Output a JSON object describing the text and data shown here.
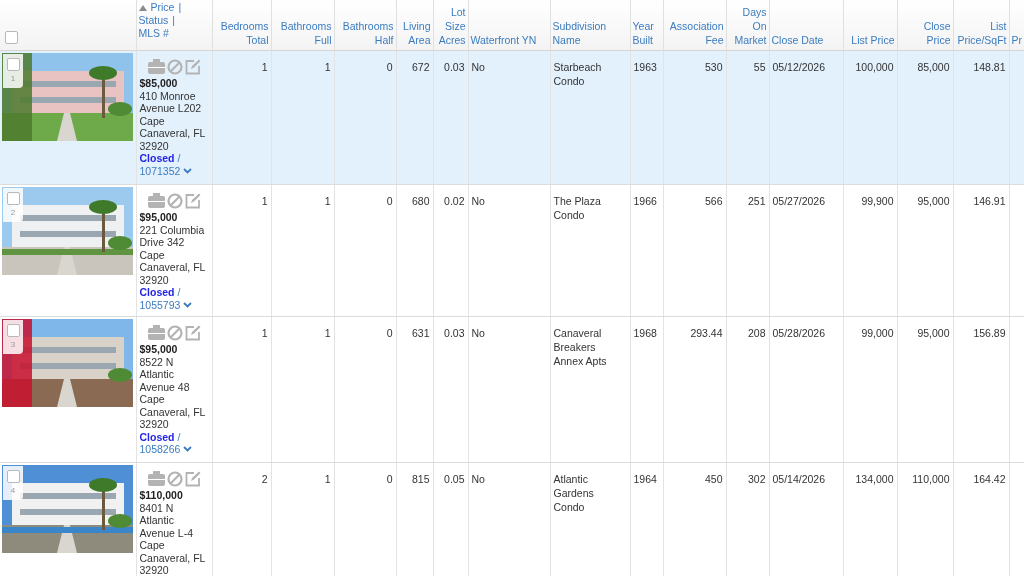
{
  "header": {
    "select_all_checked": false,
    "price_column": [
      {
        "text": "Price",
        "sep": "|"
      },
      {
        "text": "Status",
        "sep": "|"
      },
      {
        "text": "MLS #"
      }
    ],
    "columns": [
      {
        "label": "Bedrooms Total",
        "kind": "number"
      },
      {
        "label": "Bathrooms Full",
        "kind": "number"
      },
      {
        "label": "Bathrooms Half",
        "kind": "number"
      },
      {
        "label": "Living Area",
        "kind": "number"
      },
      {
        "label": "Lot Size Acres",
        "kind": "number"
      },
      {
        "label": "Waterfront YN",
        "kind": "text"
      },
      {
        "label": "Subdivision Name",
        "kind": "text"
      },
      {
        "label": "Year Built",
        "kind": "text"
      },
      {
        "label": "Association Fee",
        "kind": "number"
      },
      {
        "label": "Days On Market",
        "kind": "number"
      },
      {
        "label": "Close Date",
        "kind": "text"
      },
      {
        "label": "List Price",
        "kind": "number"
      },
      {
        "label": "Close Price",
        "kind": "number"
      },
      {
        "label": "List Price/SqFt",
        "kind": "number"
      },
      {
        "label": "Pr",
        "kind": "text"
      }
    ]
  },
  "rows": [
    {
      "number": "1",
      "selected": true,
      "checked": false,
      "price": "$85,000",
      "address": "410 Monroe Avenue L202 Cape Canaveral, FL 32920",
      "status": "Closed",
      "separator": "/",
      "mls": "1071352",
      "cells": [
        "1",
        "1",
        "0",
        "672",
        "0.03",
        "No",
        "Starbeach Condo",
        "1963",
        "530",
        "55",
        "05/12/2026",
        "100,000",
        "85,000",
        "148.81"
      ]
    },
    {
      "number": "2",
      "selected": false,
      "checked": false,
      "price": "$95,000",
      "address": "221 Columbia Drive 342 Cape Canaveral, FL 32920",
      "status": "Closed",
      "separator": "/",
      "mls": "1055793",
      "cells": [
        "1",
        "1",
        "0",
        "680",
        "0.02",
        "No",
        "The Plaza Condo",
        "1966",
        "566",
        "251",
        "05/27/2026",
        "99,900",
        "95,000",
        "146.91"
      ]
    },
    {
      "number": "3",
      "selected": false,
      "checked": false,
      "price": "$95,000",
      "address": "8522 N Atlantic Avenue 48 Cape Canaveral, FL 32920",
      "status": "Closed",
      "separator": "/",
      "mls": "1058266",
      "cells": [
        "1",
        "1",
        "0",
        "631",
        "0.03",
        "No",
        "Canaveral Breakers Annex Apts",
        "1968",
        "293.44",
        "208",
        "05/28/2026",
        "99,000",
        "95,000",
        "156.89"
      ]
    },
    {
      "number": "4",
      "selected": false,
      "checked": false,
      "price": "$110,000",
      "address": "8401 N Atlantic Avenue L-4 Cape Canaveral, FL 32920",
      "cells": [
        "2",
        "1",
        "0",
        "815",
        "0.05",
        "No",
        "Atlantic Gardens Condo",
        "1964",
        "450",
        "302",
        "05/14/2026",
        "134,000",
        "110,000",
        "164.42"
      ]
    }
  ]
}
